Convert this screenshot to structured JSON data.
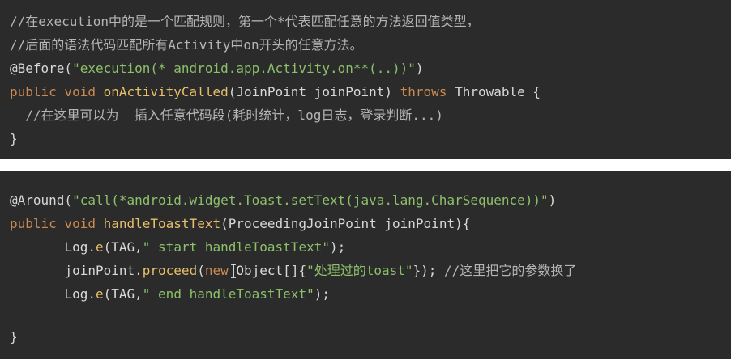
{
  "block1": {
    "line1": "//在execution中的是一个匹配规则，第一个*代表匹配任意的方法返回值类型，",
    "line2": "//后面的语法代码匹配所有Activity中on开头的任意方法。",
    "line3_annotation": "@Before(",
    "line3_string": "\"execution(* android.app.Activity.on**(..))\"",
    "line3_close": ")",
    "line4_kw1": "public void ",
    "line4_method": "onActivityCalled",
    "line4_params": "(JoinPoint joinPoint) ",
    "line4_kw2": "throws ",
    "line4_rest": "Throwable {",
    "line5": "  //在这里可以为  插入任意代码段(耗时统计，log日志，登录判断...)",
    "line6": "}"
  },
  "block2": {
    "line1_annotation": "@Around(",
    "line1_string": "\"call(*android.widget.Toast.setText(java.lang.CharSequence))\"",
    "line1_close": ")",
    "line2_kw": "public void ",
    "line2_method": "handleToastText",
    "line2_rest": "(ProceedingJoinPoint joinPoint){",
    "line3_indent": "       Log.",
    "line3_method": "e",
    "line3_open": "(TAG,",
    "line3_string": "\" start handleToastText\"",
    "line3_close": ");",
    "line4_indent": "       joinPoint.",
    "line4_method": "proceed",
    "line4_open": "(",
    "line4_kw": "new",
    "line4_mid": " Object[]{",
    "line4_string": "\"处理过的toast\"",
    "line4_close": "}); ",
    "line4_comment": "//这里把它的参数换了",
    "line5_indent": "       Log.",
    "line5_method": "e",
    "line5_open": "(TAG,",
    "line5_string": "\" end handleToastText\"",
    "line5_close": ");",
    "line6": "}"
  }
}
